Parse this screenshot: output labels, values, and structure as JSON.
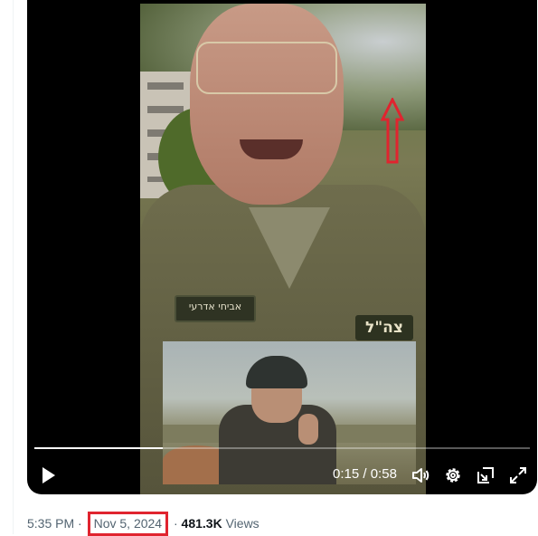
{
  "video": {
    "name_tag_text": "אביחי אדרעי",
    "unit_tag_text": "צה\"ל",
    "current_time": "0:15",
    "separator": "/",
    "duration": "0:58",
    "progress_fraction": 0.26
  },
  "post_meta": {
    "time": "5:35 PM",
    "dot1": "·",
    "date": "Nov 5, 2024",
    "dot2": "·",
    "views_count": "481.3K",
    "views_label": "Views"
  },
  "colors": {
    "highlight_box": "#e0242f",
    "meta_text": "#536471",
    "views_text": "#0f1419"
  },
  "icons": [
    "play-icon",
    "volume-icon",
    "settings-icon",
    "popout-icon",
    "fullscreen-icon",
    "annotation-arrow-icon"
  ]
}
